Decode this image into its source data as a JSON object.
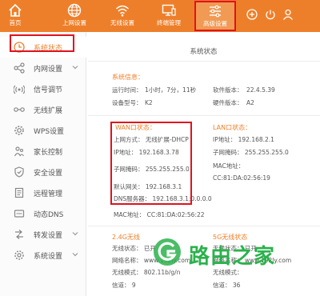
{
  "nav": {
    "home": "首页",
    "internet": "上网设置",
    "wireless": "无线设置",
    "terminal": "终端管理",
    "advanced": "高级设置"
  },
  "sidebar": {
    "items": [
      {
        "label": "系统状态"
      },
      {
        "label": "内网设置"
      },
      {
        "label": "信号调节"
      },
      {
        "label": "无线扩展"
      },
      {
        "label": "WPS设置"
      },
      {
        "label": "家长控制"
      },
      {
        "label": "安全设置"
      },
      {
        "label": "远程管理"
      },
      {
        "label": "动态DNS"
      },
      {
        "label": "转发设置"
      },
      {
        "label": "系统设置"
      }
    ]
  },
  "main": {
    "title": "系统状态",
    "sysinfo": {
      "heading": "系统信息：",
      "uptime_label": "运行时间：",
      "uptime_value": "1小时，7分，11秒",
      "model_label": "设备型号：",
      "model_value": "K2",
      "sw_label": "软件版本：",
      "sw_value": "22.4.5.39",
      "hw_label": "硬件版本：",
      "hw_value": "A2"
    },
    "wan": {
      "heading": "WAN口状态：",
      "mode": "上网方式：  无线扩展-DHCP",
      "ip": "IP地址：  192.168.3.78",
      "mask": "子网掩码：  255.255.255.0",
      "gateway": "默认网关：  192.168.3.1",
      "dns": "DNS服务器：  192.168.3.1;0.0.0.0",
      "mac": "MAC地址：  CC:81:DA:02:56:22"
    },
    "lan": {
      "heading": "LAN口状态：",
      "ip": "IP地址：  192.168.2.1",
      "mask": "子网掩码：  255.255.255.0",
      "mac_label": "MAC地址：",
      "mac_value": "CC:81:DA:02:56:19"
    },
    "w24": {
      "heading": "2.4G无线",
      "state": "无线状态：  已开",
      "ssid": "网络名称：  www.192ly.com",
      "mode": "无线模式：  802.11b/g/n",
      "channel": "信道：  9"
    },
    "w5": {
      "heading": "5G无线状态",
      "state": "无线状态：  已开",
      "ssid": "网络名称：  www.192ly.com",
      "mode": "无线模式：",
      "channel": "信道：  36"
    }
  },
  "watermark": {
    "text": "路由之家"
  },
  "colors": {
    "accent": "#ee7f2a",
    "highlight": "#e0121d",
    "watermark": "#2bb24c"
  },
  "icons": {
    "nav": [
      "home-icon",
      "globe-icon",
      "wifi-icon",
      "monitor-icon",
      "sliders-icon"
    ],
    "topright": [
      "plus-circle-icon",
      "power-icon",
      "user-icon"
    ]
  }
}
